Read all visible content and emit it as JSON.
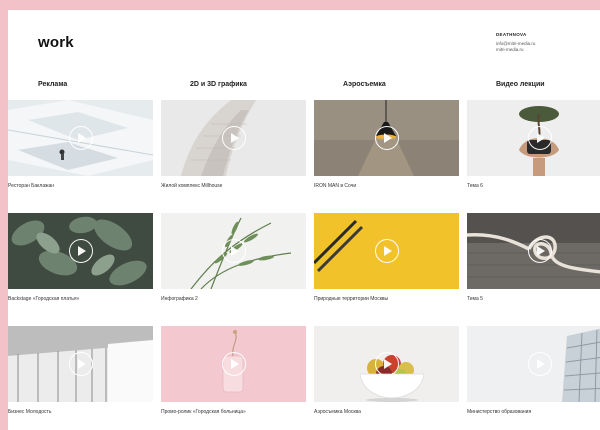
{
  "header": {
    "logo": "work",
    "contact_title": "DEATHNOVA",
    "contact_lines": [
      "info@mitri-media.ru",
      "mitri-media.ru"
    ]
  },
  "categories": [
    "Реклама",
    "2D и 3D графика",
    "Аэросъемка",
    "Видео лекции"
  ],
  "videos": [
    {
      "title": "Ресторан Баклажан",
      "icon": "play-icon"
    },
    {
      "title": "Жилой комплекс Millhouse",
      "icon": "play-icon"
    },
    {
      "title": "IRON MAN в Сочи",
      "icon": "play-icon"
    },
    {
      "title": "Тема 6",
      "icon": "play-icon"
    },
    {
      "title": "Backstage «Городская платья»",
      "icon": "play-icon"
    },
    {
      "title": "Инфографика 2",
      "icon": "play-icon"
    },
    {
      "title": "Природные территории Москвы",
      "icon": "play-icon"
    },
    {
      "title": "Тема 5",
      "icon": "play-icon"
    },
    {
      "title": "Бизнес Молодость",
      "icon": "play-icon"
    },
    {
      "title": "Промо-ролик «Городская больница»",
      "icon": "play-icon"
    },
    {
      "title": "Аэросъемка Москва",
      "icon": "play-icon"
    },
    {
      "title": "Министерство образования",
      "icon": "play-icon"
    }
  ],
  "colors": {
    "frame": "#f2c2c8",
    "page": "#ffffff",
    "text": "#222222"
  }
}
